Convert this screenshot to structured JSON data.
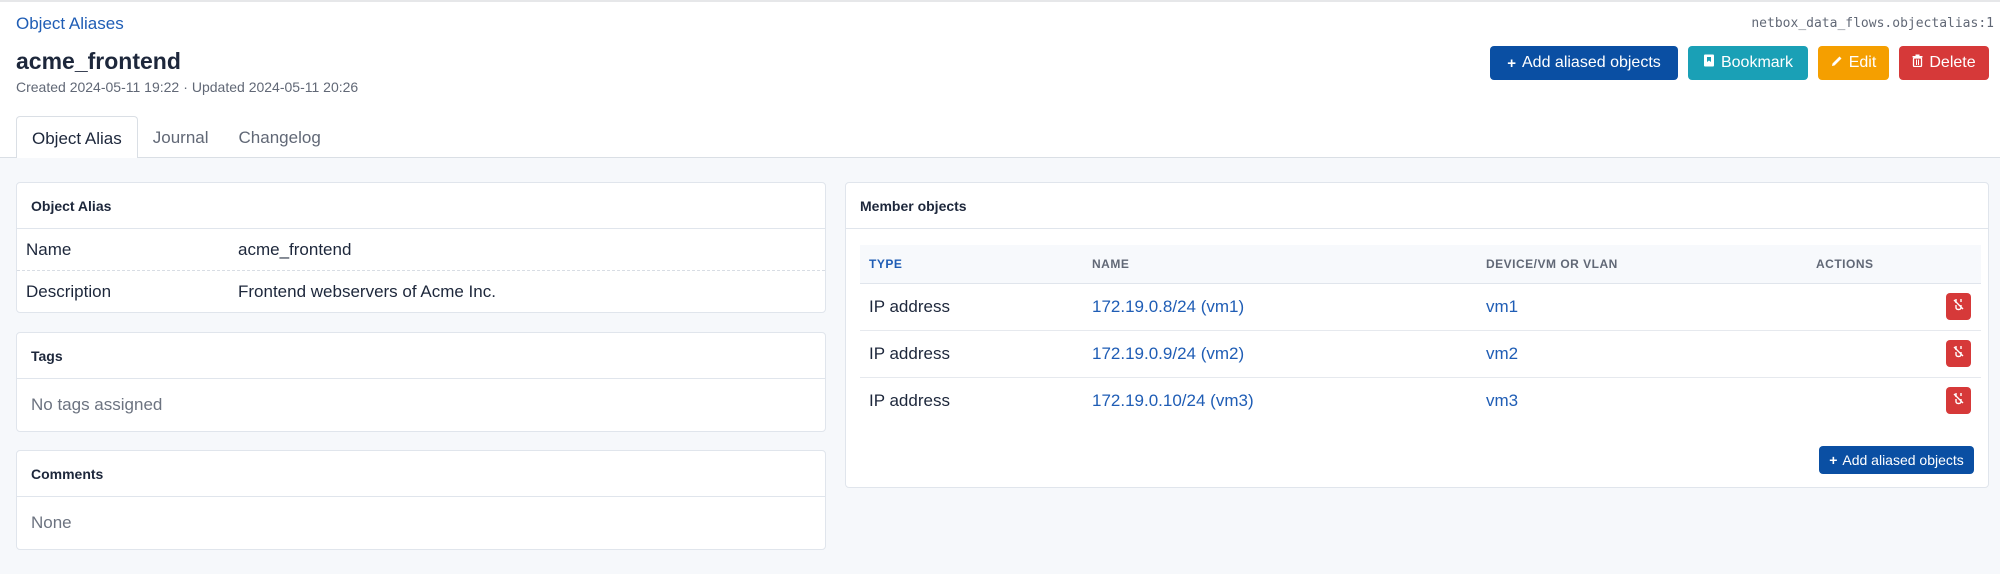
{
  "breadcrumb": {
    "label": "Object Aliases"
  },
  "object_id": "netbox_data_flows.objectalias:1",
  "title": "acme_frontend",
  "meta": {
    "created": "Created 2024-05-11 19:22",
    "separator": "·",
    "updated": "Updated 2024-05-11 20:26"
  },
  "actions": {
    "add_label": "Add aliased objects",
    "bookmark_label": "Bookmark",
    "edit_label": "Edit",
    "delete_label": "Delete"
  },
  "tabs": [
    {
      "label": "Object Alias",
      "active": true
    },
    {
      "label": "Journal"
    },
    {
      "label": "Changelog"
    }
  ],
  "object_alias_card": {
    "title": "Object Alias",
    "rows": [
      {
        "label": "Name",
        "value": "acme_frontend"
      },
      {
        "label": "Description",
        "value": "Frontend webservers of Acme Inc."
      }
    ]
  },
  "tags_card": {
    "title": "Tags",
    "empty": "No tags assigned"
  },
  "comments_card": {
    "title": "Comments",
    "empty": "None"
  },
  "members_card": {
    "title": "Member objects",
    "columns": [
      "TYPE",
      "NAME",
      "DEVICE/VM OR VLAN",
      "ACTIONS"
    ],
    "rows": [
      {
        "type": "IP address",
        "name": "172.19.0.8/24 (vm1)",
        "parent": "vm1"
      },
      {
        "type": "IP address",
        "name": "172.19.0.9/24 (vm2)",
        "parent": "vm2"
      },
      {
        "type": "IP address",
        "name": "172.19.0.10/24 (vm3)",
        "parent": "vm3"
      }
    ],
    "add_label": "Add aliased objects"
  },
  "colors": {
    "primary": "#0a4fa3",
    "info": "#1aa0b6",
    "warning": "#f59f00",
    "danger": "#d63939",
    "link": "#1f5db5"
  }
}
